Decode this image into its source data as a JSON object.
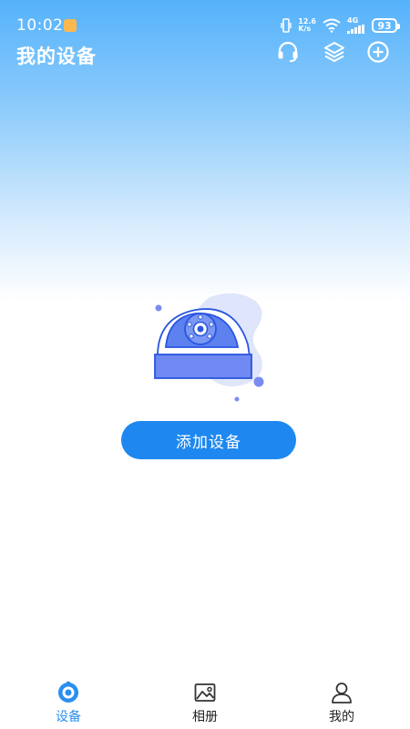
{
  "status_bar": {
    "time": "10:02",
    "net_speed_value": "12.6",
    "net_speed_unit": "K/s",
    "network": "4G",
    "battery": "93"
  },
  "header": {
    "title": "我的设备",
    "icons": [
      "headset-icon",
      "layers-icon",
      "add-circle-icon"
    ]
  },
  "main": {
    "add_device_label": "添加设备"
  },
  "bottom_nav": {
    "items": [
      {
        "label": "设备",
        "icon": "camera-device-icon",
        "active": true
      },
      {
        "label": "相册",
        "icon": "photo-album-icon",
        "active": false
      },
      {
        "label": "我的",
        "icon": "person-icon",
        "active": false
      }
    ]
  },
  "colors": {
    "accent": "#1e88f0",
    "header_gradient_top": "#55b2fb",
    "active_tab": "#2a8ff0"
  }
}
